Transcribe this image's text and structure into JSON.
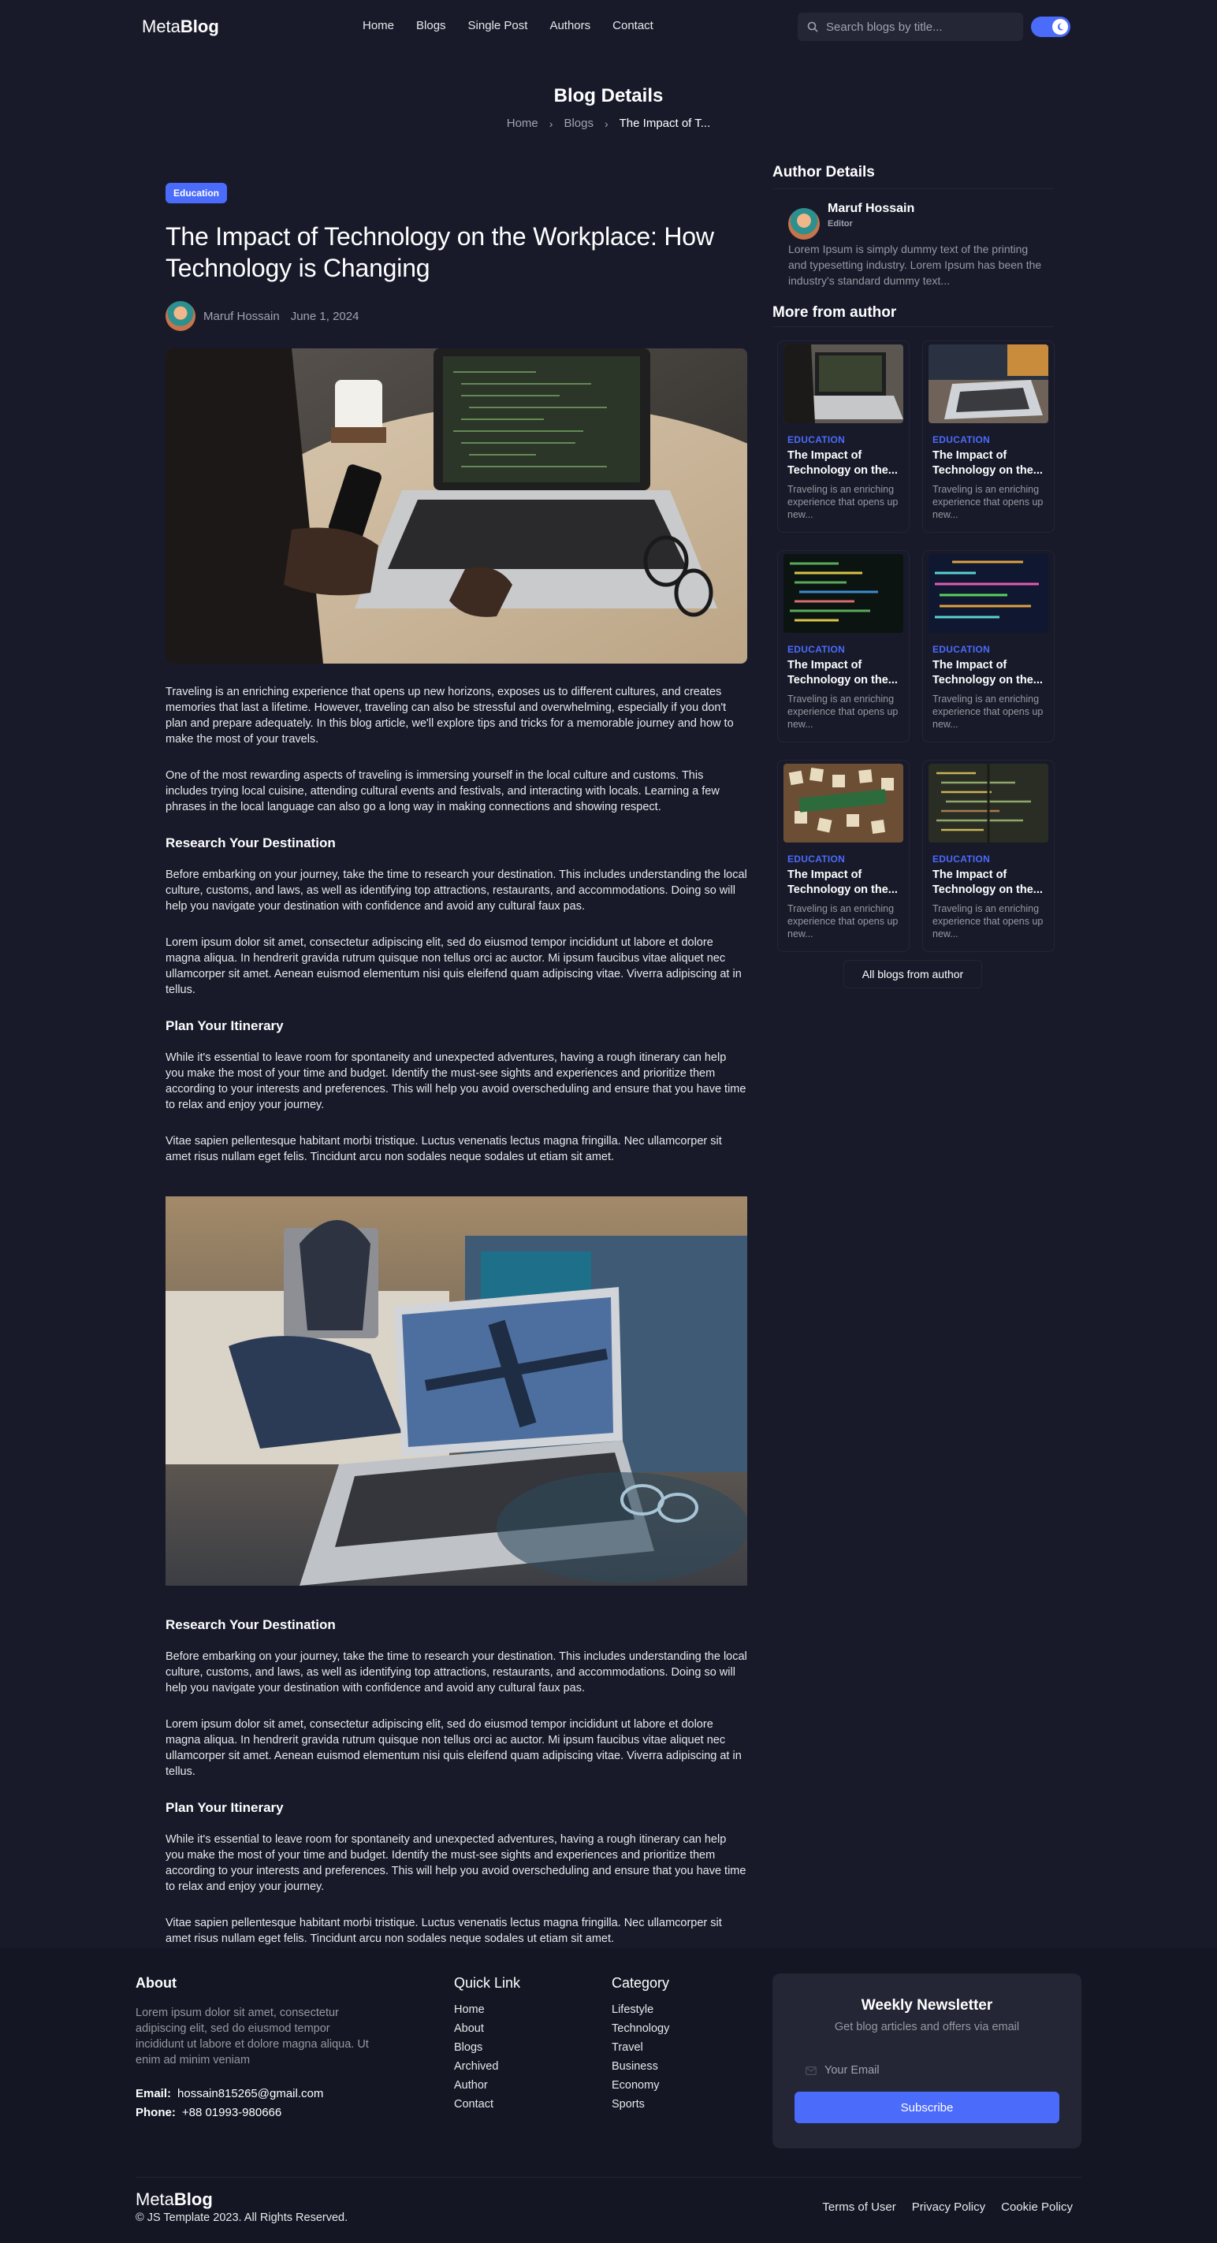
{
  "header": {
    "logo_light": "Meta",
    "logo_bold": "Blog",
    "nav": [
      "Home",
      "Blogs",
      "Single Post",
      "Authors",
      "Contact"
    ],
    "search_placeholder": "Search blogs by title..."
  },
  "page": {
    "title": "Blog Details",
    "breadcrumb": [
      "Home",
      "Blogs",
      "The Impact of T..."
    ]
  },
  "article": {
    "category": "Education",
    "title": "The Impact of Technology on the Workplace: How Technology is Changing",
    "author": "Maruf Hossain",
    "date": "June 1, 2024",
    "blocks": {
      "p1": "Traveling is an enriching experience that opens up new horizons, exposes us to different cultures, and creates memories that last a lifetime. However, traveling can also be stressful and overwhelming, especially if you don't plan and prepare adequately. In this blog article, we'll explore tips and tricks for a memorable journey and how to make the most of your travels.",
      "p2": "One of the most rewarding aspects of traveling is immersing yourself in the local culture and customs. This includes trying local cuisine, attending cultural events and festivals, and interacting with locals. Learning a few phrases in the local language can also go a long way in making connections and showing respect.",
      "h1": "Research Your Destination",
      "p3": "Before embarking on your journey, take the time to research your destination. This includes understanding the local culture, customs, and laws, as well as identifying top attractions, restaurants, and accommodations. Doing so will help you navigate your destination with confidence and avoid any cultural faux pas.",
      "p4": "Lorem ipsum dolor sit amet, consectetur adipiscing elit, sed do eiusmod tempor incididunt ut labore et dolore magna aliqua. In hendrerit gravida rutrum quisque non tellus orci ac auctor. Mi ipsum faucibus vitae aliquet nec ullamcorper sit amet. Aenean euismod elementum nisi quis eleifend quam adipiscing vitae. Viverra adipiscing at in tellus.",
      "h2": "Plan Your Itinerary",
      "p5": "While it's essential to leave room for spontaneity and unexpected adventures, having a rough itinerary can help you make the most of your time and budget. Identify the must-see sights and experiences and prioritize them according to your interests and preferences. This will help you avoid overscheduling and ensure that you have time to relax and enjoy your journey.",
      "p6": "Vitae sapien pellentesque habitant morbi tristique. Luctus venenatis lectus magna fringilla. Nec ullamcorper sit amet risus nullam eget felis. Tincidunt arcu non sodales neque sodales ut etiam sit amet."
    }
  },
  "sidebar": {
    "author_heading": "Author Details",
    "author_name": "Maruf Hossain",
    "author_role": "Editor",
    "author_bio": "Lorem Ipsum is simply dummy text of the printing and typesetting industry. Lorem Ipsum has been the industry's standard dummy text...",
    "more_heading": "More from author",
    "cards": [
      {
        "category": "EDUCATION",
        "title": "The Impact of Technology on the...",
        "desc": "Traveling is an enriching experience that opens up new..."
      },
      {
        "category": "EDUCATION",
        "title": "The Impact of Technology on the...",
        "desc": "Traveling is an enriching experience that opens up new..."
      },
      {
        "category": "EDUCATION",
        "title": "The Impact of Technology on the...",
        "desc": "Traveling is an enriching experience that opens up new..."
      },
      {
        "category": "EDUCATION",
        "title": "The Impact of Technology on the...",
        "desc": "Traveling is an enriching experience that opens up new..."
      },
      {
        "category": "EDUCATION",
        "title": "The Impact of Technology on the...",
        "desc": "Traveling is an enriching experience that opens up new..."
      },
      {
        "category": "EDUCATION",
        "title": "The Impact of Technology on the...",
        "desc": "Traveling is an enriching experience that opens up new..."
      }
    ],
    "all_blogs_label": "All blogs from author"
  },
  "footer": {
    "about_heading": "About",
    "about_text": "Lorem ipsum dolor sit amet, consectetur adipiscing elit, sed do eiusmod tempor incididunt ut labore et dolore magna aliqua. Ut enim ad minim veniam",
    "email_label": "Email:",
    "email": "hossain815265@gmail.com",
    "phone_label": "Phone:",
    "phone": "+88 01993-980666",
    "quick_heading": "Quick Link",
    "quick_links": [
      "Home",
      "About",
      "Blogs",
      "Archived",
      "Author",
      "Contact"
    ],
    "category_heading": "Category",
    "categories": [
      "Lifestyle",
      "Technology",
      "Travel",
      "Business",
      "Economy",
      "Sports"
    ],
    "newsletter_heading": "Weekly Newsletter",
    "newsletter_text": "Get blog articles and offers via email",
    "email_placeholder": "Your Email",
    "subscribe_label": "Subscribe",
    "logo_light": "Meta",
    "logo_bold": "Blog",
    "copyright": "© JS Template 2023. All Rights Reserved.",
    "legal_links": [
      "Terms of User",
      "Privacy Policy",
      "Cookie Policy"
    ]
  },
  "colors": {
    "background": "#181a2a",
    "surface": "#242535",
    "footer": "#141624",
    "accent": "#4b6bfb",
    "muted": "#97989f"
  }
}
